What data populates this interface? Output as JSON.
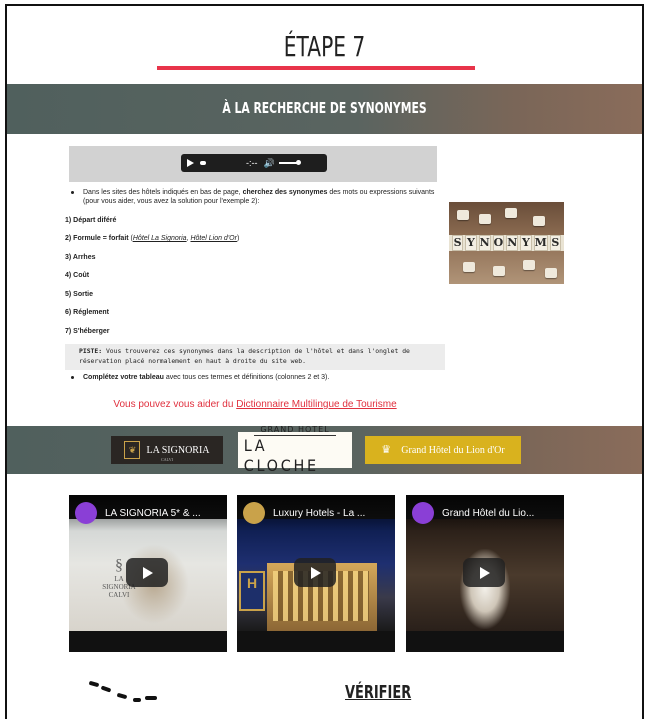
{
  "step": {
    "title": "ÉTAPE 7",
    "accent_color": "#e8344a"
  },
  "section": {
    "title": "À LA RECHERCHE DE SYNONYMES"
  },
  "audio": {
    "time": "-:--"
  },
  "instructions": {
    "intro_part1": "Dans les sites des hôtels indiqués en bas de page, ",
    "intro_bold": "cherchez des synonymes",
    "intro_part2": " des mots ou expressions suivants (pour vous aider, vous avez la solution pour l'exemple 2):",
    "items": [
      "1) Départ diféré",
      "2) Formule = forfait",
      "3) Arrhes",
      "4) Coût",
      "5) Sortie",
      "6) Réglement",
      "7) S'héberger"
    ],
    "item2_open": " (",
    "item2_link1": "Hôtel La Signoria",
    "item2_sep": ", ",
    "item2_link2": "Hôtel Lion d'Or",
    "item2_close": ")",
    "piste_label": "PISTE:",
    "piste_text": " Vous trouverez ces synonymes dans la description de l'hôtel et dans l'onglet de réservation placé normalement en haut à droite du site web.",
    "complete_bold": "Complétez votre tableau",
    "complete_text": " avec tous ces termes et définitions (colonnes 2 et 3).",
    "help_text": "Vous pouvez vous aider du ",
    "help_link": "Dictionnaire Multilingue de Tourisme",
    "help_color": "#e0303e"
  },
  "synonyms_image": {
    "letters": [
      "S",
      "Y",
      "N",
      "O",
      "N",
      "Y",
      "M",
      "S"
    ]
  },
  "hotel_logos": {
    "signoria": {
      "name": "LA SIGNORIA",
      "sub": "CALVI"
    },
    "cloche": {
      "line1": "GRAND HOTEL",
      "line2": "LA CLOCHE"
    },
    "lion": {
      "name": "Grand Hôtel du Lion d'Or"
    }
  },
  "videos": [
    {
      "title": "LA SIGNORIA 5* & ...",
      "avatar_color": "#8a3fd6",
      "brand": "LA SIGNORIA",
      "brand_sub": "CALVI"
    },
    {
      "title": "Luxury Hotels - La ...",
      "avatar_color": "#c9a24a",
      "hbox": "H"
    },
    {
      "title": "Grand Hôtel du Lio...",
      "avatar_color": "#8a3fd6"
    }
  ],
  "footer": {
    "verify_label": "VÉRIFIER"
  }
}
